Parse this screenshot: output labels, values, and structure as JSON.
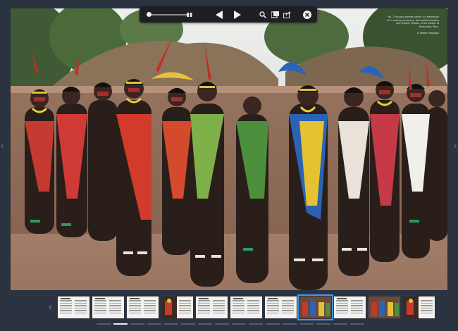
{
  "photo": {
    "caption": "Fig. 7: Kayapo women dance in celebration of a naming ceremony, with painted bodies and feather regalia, in the village of Moikarako, Para.",
    "credit": "© Jamie Simpson"
  },
  "toolbar": {
    "icons": [
      "slider",
      "grid-icon",
      "prev-icon",
      "next-icon",
      "search-icon",
      "bookmarks-icon",
      "share-icon",
      "close-icon"
    ]
  },
  "filmstrip": {
    "selected_index": 7,
    "thumbs": [
      {
        "kind": "text"
      },
      {
        "kind": "text"
      },
      {
        "kind": "text"
      },
      {
        "kind": "mixed"
      },
      {
        "kind": "text"
      },
      {
        "kind": "text"
      },
      {
        "kind": "text"
      },
      {
        "kind": "photo"
      },
      {
        "kind": "text"
      },
      {
        "kind": "photo"
      },
      {
        "kind": "mixed"
      }
    ]
  },
  "pager": {
    "total": 16,
    "active": 1
  },
  "colors": {
    "background": "#2b3240",
    "selection": "#3b9be8",
    "toolbar": "#1d1f23"
  }
}
